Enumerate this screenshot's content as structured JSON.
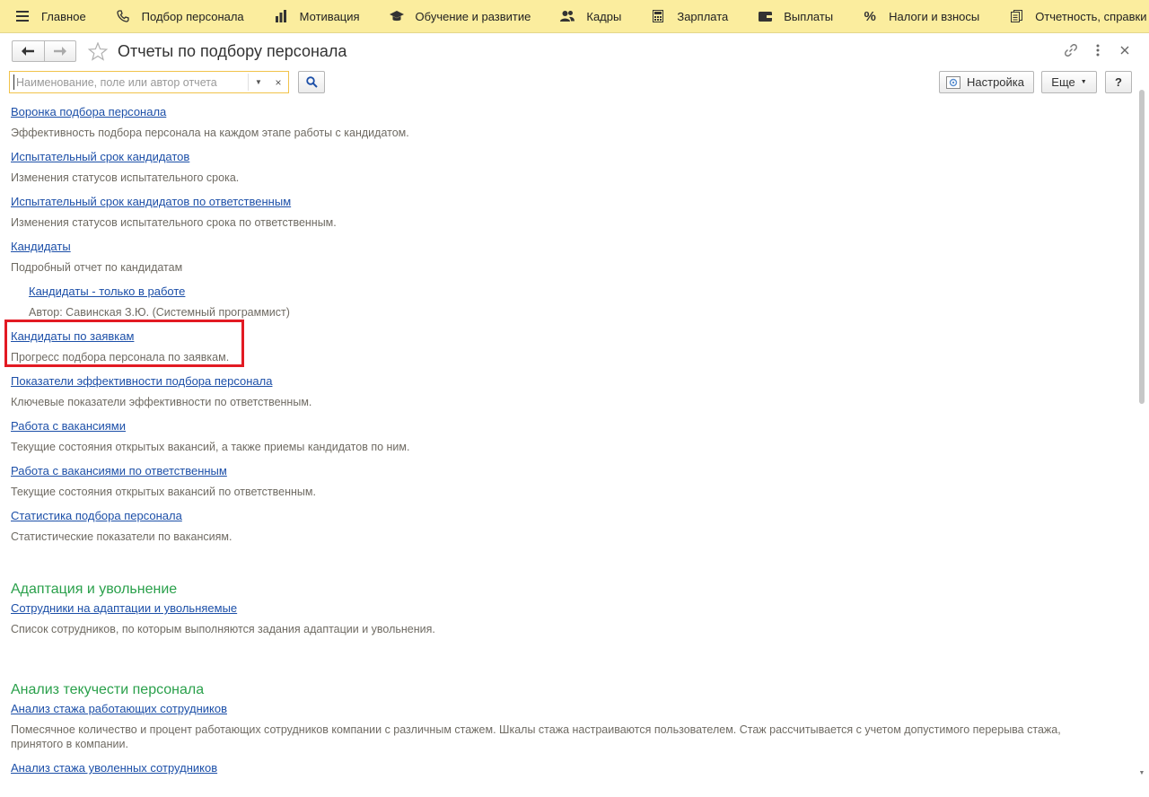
{
  "topbar": {
    "items": [
      {
        "label": "Главное",
        "icon": "menu-icon"
      },
      {
        "label": "Подбор персонала",
        "icon": "phone-icon"
      },
      {
        "label": "Мотивация",
        "icon": "bars-icon"
      },
      {
        "label": "Обучение и развитие",
        "icon": "graduation-cap-icon"
      },
      {
        "label": "Кадры",
        "icon": "people-icon"
      },
      {
        "label": "Зарплата",
        "icon": "calculator-icon"
      },
      {
        "label": "Выплаты",
        "icon": "wallet-icon"
      },
      {
        "label": "Налоги и взносы",
        "icon": "percent-icon"
      },
      {
        "label": "Отчетность, справки",
        "icon": "documents-icon"
      }
    ]
  },
  "header": {
    "title": "Отчеты по подбору персонала"
  },
  "search": {
    "placeholder": "Наименование, поле или автор отчета",
    "value": ""
  },
  "toolbar": {
    "settings_label": "Настройка",
    "more_label": "Еще",
    "help_label": "?"
  },
  "reports": {
    "r0": {
      "title": "Воронка подбора персонала",
      "desc": "Эффективность подбора персонала на каждом этапе работы с кандидатом."
    },
    "r1": {
      "title": "Испытательный срок кандидатов",
      "desc": "Изменения статусов испытательного срока."
    },
    "r2": {
      "title": "Испытательный срок кандидатов по ответственным",
      "desc": "Изменения статусов испытательного срока по ответственным."
    },
    "r3": {
      "title": "Кандидаты",
      "desc": "Подробный отчет по кандидатам"
    },
    "r3a": {
      "title": "Кандидаты - только в работе",
      "desc": "Автор: Савинская З.Ю. (Системный программист)"
    },
    "r4": {
      "title": "Кандидаты по заявкам",
      "desc": "Прогресс подбора персонала по заявкам."
    },
    "r5": {
      "title": "Показатели эффективности подбора персонала",
      "desc": "Ключевые показатели эффективности по ответственным."
    },
    "r6": {
      "title": "Работа с вакансиями",
      "desc": "Текущие состояния открытых вакансий, а также приемы кандидатов по ним."
    },
    "r7": {
      "title": "Работа с вакансиями по ответственным",
      "desc": "Текущие состояния открытых вакансий по ответственным."
    },
    "r8": {
      "title": "Статистика подбора персонала",
      "desc": "Статистические показатели по вакансиям."
    }
  },
  "sections": {
    "adaptation": {
      "title": "Адаптация и увольнение",
      "r0": {
        "title": "Сотрудники на адаптации и увольняемые",
        "desc": "Список сотрудников, по которым выполняются задания адаптации и увольнения."
      }
    },
    "turnover": {
      "title": "Анализ текучести персонала",
      "r0": {
        "title": "Анализ стажа работающих сотрудников",
        "desc": "Помесячное количество и процент работающих сотрудников компании с различным стажем. Шкалы стажа настраиваются пользователем. Стаж рассчитывается с учетом допустимого перерыва стажа, принятого в компании."
      },
      "r1": {
        "title": "Анализ стажа уволенных сотрудников"
      }
    }
  },
  "colors": {
    "topbar_bg": "#fbed9e",
    "link": "#1c4fa8",
    "section": "#2aa04b",
    "highlight": "#e21a23"
  }
}
